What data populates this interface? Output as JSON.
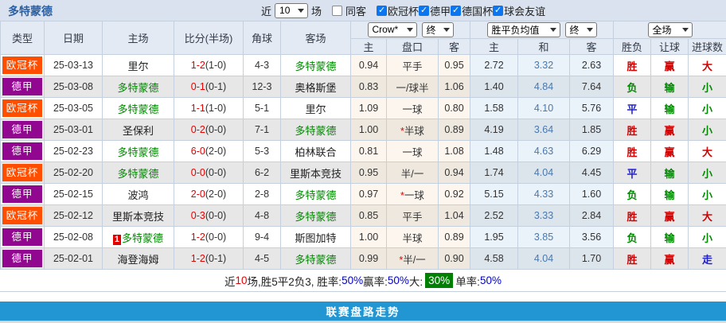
{
  "colors": {
    "title": "#2b5fa3",
    "footer_bar": "#2196d3",
    "summary_green_badge_bg": "#008000",
    "league_colors": {
      "欧冠杯": "#ff4e00",
      "德甲": "#91078f"
    },
    "team_highlight": "#008800",
    "score_red": "#e60000"
  },
  "header": {
    "title": "多特蒙德",
    "recent_label": "近",
    "recent_value": "10",
    "games_label": "场",
    "same_opponent": {
      "label": "同客",
      "checked": false
    },
    "leagues": [
      {
        "label": "欧冠杯",
        "checked": true
      },
      {
        "label": "德甲",
        "checked": true
      },
      {
        "label": "德国杯",
        "checked": true
      },
      {
        "label": "球会友谊",
        "checked": true
      }
    ]
  },
  "table_head": {
    "col_type": "类型",
    "col_date": "日期",
    "col_home": "主场",
    "col_score": "比分(半场)",
    "col_corner": "角球",
    "col_away": "客场",
    "dd_company": "Crow*",
    "dd_final1": "终",
    "dd_odds": "胜平负均值",
    "dd_final2": "终",
    "dd_scope": "全场",
    "sub_home1": "主",
    "sub_handicap": "盘口",
    "sub_away1": "客",
    "sub_home2": "主",
    "sub_draw": "和",
    "sub_away2": "客",
    "col_result": "胜负",
    "col_handicap_result": "让球",
    "col_goals": "进球数"
  },
  "rows": [
    {
      "type": "欧冠杯",
      "date": "25-03-13",
      "home": "里尔",
      "home_badge": "",
      "away": "多特蒙德",
      "highlight": "away",
      "score": "1-2",
      "half": "(1-0)",
      "corner": "4-3",
      "h1": "0.94",
      "handicap": "平手",
      "a1": "0.95",
      "win": "2.72",
      "draw": "3.32",
      "lose": "2.63",
      "result": "胜",
      "hresult": "赢",
      "goals": "大"
    },
    {
      "type": "德甲",
      "date": "25-03-08",
      "home": "多特蒙德",
      "home_badge": "",
      "away": "奥格斯堡",
      "highlight": "home",
      "score": "0-1",
      "half": "(0-1)",
      "corner": "12-3",
      "h1": "0.83",
      "handicap": "一/球半",
      "a1": "1.06",
      "win": "1.40",
      "draw": "4.84",
      "lose": "7.64",
      "result": "负",
      "hresult": "输",
      "goals": "小"
    },
    {
      "type": "欧冠杯",
      "date": "25-03-05",
      "home": "多特蒙德",
      "home_badge": "",
      "away": "里尔",
      "highlight": "home",
      "score": "1-1",
      "half": "(1-0)",
      "corner": "5-1",
      "h1": "1.09",
      "handicap": "一球",
      "a1": "0.80",
      "win": "1.58",
      "draw": "4.10",
      "lose": "5.76",
      "result": "平",
      "hresult": "输",
      "goals": "小"
    },
    {
      "type": "德甲",
      "date": "25-03-01",
      "home": "圣保利",
      "home_badge": "",
      "away": "多特蒙德",
      "highlight": "away",
      "score": "0-2",
      "half": "(0-0)",
      "corner": "7-1",
      "h1": "1.00",
      "handicap": "*半球",
      "a1": "0.89",
      "win": "4.19",
      "draw": "3.64",
      "lose": "1.85",
      "result": "胜",
      "hresult": "赢",
      "goals": "小"
    },
    {
      "type": "德甲",
      "date": "25-02-23",
      "home": "多特蒙德",
      "home_badge": "",
      "away": "柏林联合",
      "highlight": "home",
      "score": "6-0",
      "half": "(2-0)",
      "corner": "5-3",
      "h1": "0.81",
      "handicap": "一球",
      "a1": "1.08",
      "win": "1.48",
      "draw": "4.63",
      "lose": "6.29",
      "result": "胜",
      "hresult": "赢",
      "goals": "大"
    },
    {
      "type": "欧冠杯",
      "date": "25-02-20",
      "home": "多特蒙德",
      "home_badge": "",
      "away": "里斯本竞技",
      "highlight": "home",
      "score": "0-0",
      "half": "(0-0)",
      "corner": "6-2",
      "h1": "0.95",
      "handicap": "半/一",
      "a1": "0.94",
      "win": "1.74",
      "draw": "4.04",
      "lose": "4.45",
      "result": "平",
      "hresult": "输",
      "goals": "小"
    },
    {
      "type": "德甲",
      "date": "25-02-15",
      "home": "波鸿",
      "home_badge": "",
      "away": "多特蒙德",
      "highlight": "away",
      "score": "2-0",
      "half": "(2-0)",
      "corner": "2-8",
      "h1": "0.97",
      "handicap": "*一球",
      "a1": "0.92",
      "win": "5.15",
      "draw": "4.33",
      "lose": "1.60",
      "result": "负",
      "hresult": "输",
      "goals": "小"
    },
    {
      "type": "欧冠杯",
      "date": "25-02-12",
      "home": "里斯本竞技",
      "home_badge": "",
      "away": "多特蒙德",
      "highlight": "away",
      "score": "0-3",
      "half": "(0-0)",
      "corner": "4-8",
      "h1": "0.85",
      "handicap": "平手",
      "a1": "1.04",
      "win": "2.52",
      "draw": "3.33",
      "lose": "2.84",
      "result": "胜",
      "hresult": "赢",
      "goals": "大"
    },
    {
      "type": "德甲",
      "date": "25-02-08",
      "home": "多特蒙德",
      "home_badge": "1",
      "away": "斯图加特",
      "highlight": "home",
      "score": "1-2",
      "half": "(0-0)",
      "corner": "9-4",
      "h1": "1.00",
      "handicap": "半球",
      "a1": "0.89",
      "win": "1.95",
      "draw": "3.85",
      "lose": "3.56",
      "result": "负",
      "hresult": "输",
      "goals": "小"
    },
    {
      "type": "德甲",
      "date": "25-02-01",
      "home": "海登海姆",
      "home_badge": "",
      "away": "多特蒙德",
      "highlight": "away",
      "score": "1-2",
      "half": "(0-1)",
      "corner": "4-5",
      "h1": "0.99",
      "handicap": "*半/一",
      "a1": "0.90",
      "win": "4.58",
      "draw": "4.04",
      "lose": "1.70",
      "result": "胜",
      "hresult": "赢",
      "goals": "走"
    }
  ],
  "summary_segments": [
    {
      "t": "近",
      "c": "k"
    },
    {
      "t": "10",
      "c": "r"
    },
    {
      "t": "场,胜5平2负3, 胜率:",
      "c": "k"
    },
    {
      "t": "50%",
      "c": "b"
    },
    {
      "t": " 赢率:",
      "c": "k"
    },
    {
      "t": "50%",
      "c": "b"
    },
    {
      "t": " 大:",
      "c": "k"
    },
    {
      "t": "30%",
      "c": "gbg"
    },
    {
      "t": "单率:",
      "c": "k"
    },
    {
      "t": "50%",
      "c": "b"
    }
  ],
  "footer": {
    "label": "联赛盘路走势"
  }
}
